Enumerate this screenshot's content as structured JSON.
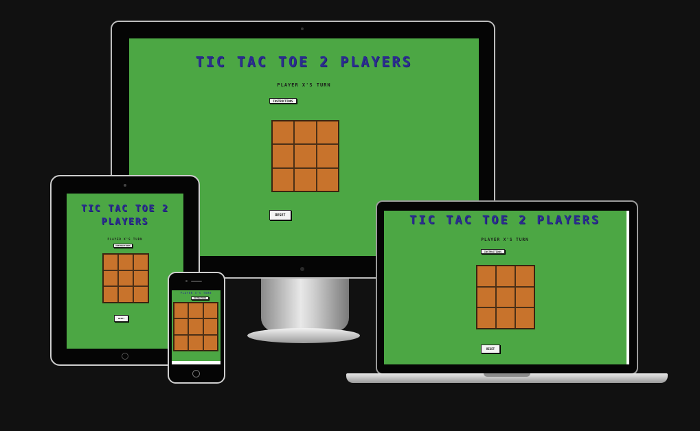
{
  "game": {
    "title": "TIC TAC TOE 2 PLAYERS",
    "title_line1": "TIC TAC TOE 2",
    "title_line2": "PLAYERS",
    "turn_text": "PLAYER X'S TURN",
    "instructions_label": "INSTRUCTIONS",
    "reset_label": "RESET",
    "board_cells": [
      "",
      "",
      "",
      "",
      "",
      "",
      "",
      "",
      ""
    ]
  },
  "colors": {
    "background": "#111111",
    "screen_green": "#4ca744",
    "title_blue": "#2b2d8f",
    "cell_orange": "#c8732c",
    "grid_lines": "#4a2f17"
  },
  "devices": [
    "desktop-monitor",
    "tablet",
    "laptop",
    "phone"
  ]
}
